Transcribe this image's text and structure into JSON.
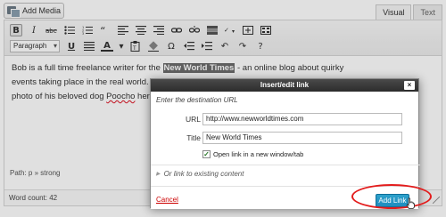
{
  "top": {
    "add_media_label": "Add Media",
    "tabs": [
      {
        "label": "Visual",
        "active": true
      },
      {
        "label": "Text",
        "active": false
      }
    ]
  },
  "toolbar": {
    "bold": "B",
    "italic": "I",
    "strike": "ABC",
    "paragraph_format": "Paragraph",
    "underline": "U",
    "text_color": "A"
  },
  "content": {
    "p1_before": "Bob is a full time freelance writer for the ",
    "highlight": "New World Times",
    "p1_after": " - an online blog about quirky",
    "p2": "events taking place in the real world. Y",
    "p3_before": "photo of his beloved dog ",
    "spell": "Poocho",
    "p3_after": " here"
  },
  "status": {
    "path": "Path: p » strong",
    "word_count": "Word count: 42"
  },
  "dialog": {
    "title": "Insert/edit link",
    "close": "×",
    "destination_label": "Enter the destination URL",
    "url_label": "URL",
    "url_value": "http://www.newworldtimes.com",
    "title_label": "Title",
    "title_value": "New World Times",
    "new_window_label": "Open link in a new window/tab",
    "new_window_checked": true,
    "existing_label": "Or link to existing content",
    "cancel_label": "Cancel",
    "add_link_label": "Add Link"
  },
  "colors": {
    "accent": "#1e8cbe",
    "highlight_ring": "#e31c1c",
    "cancel": "#cc0000"
  }
}
